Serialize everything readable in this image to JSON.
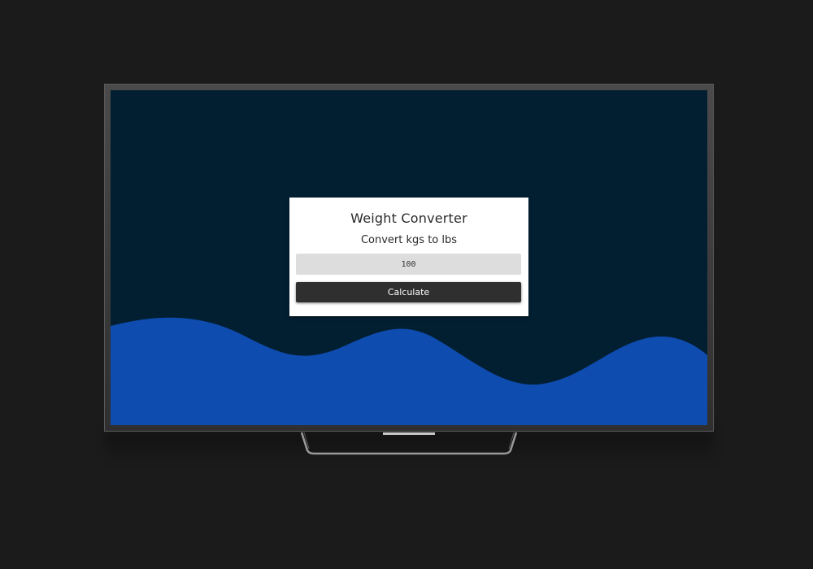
{
  "app": {
    "title": "Weight Converter",
    "subtitle": "Convert kgs to lbs"
  },
  "form": {
    "kg_input_value": "100",
    "calculate_label": "Calculate"
  },
  "colors": {
    "page_background": "#1b1b1b",
    "screen_background": "#021f32",
    "wave": "#0f4cb0",
    "card": "#ffffff",
    "input_background": "#dddddd",
    "button_background": "#2f2f2f",
    "button_text": "#ffffff"
  }
}
